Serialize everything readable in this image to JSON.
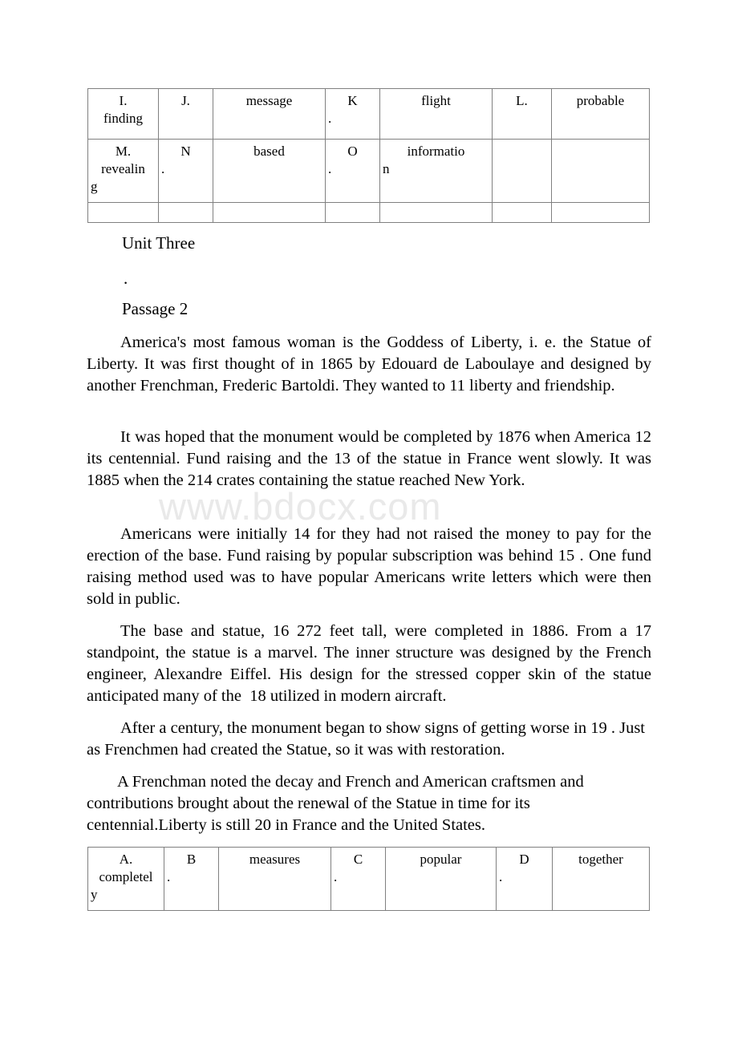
{
  "watermark": {
    "text": "www.bdocx.com"
  },
  "tables": {
    "top": {
      "rows": [
        [
          {
            "lines": [
              {
                "text": "I.",
                "align": "center"
              },
              {
                "text": "finding",
                "align": "center"
              }
            ]
          },
          {
            "lines": [
              {
                "text": "J.",
                "align": "center"
              }
            ]
          },
          {
            "lines": [
              {
                "text": "message",
                "align": "center"
              }
            ]
          },
          {
            "lines": [
              {
                "text": "K",
                "align": "center"
              },
              {
                "text": ".",
                "align": "left"
              }
            ]
          },
          {
            "lines": [
              {
                "text": "flight",
                "align": "center"
              }
            ]
          },
          {
            "lines": [
              {
                "text": "L.",
                "align": "center"
              }
            ]
          },
          {
            "lines": [
              {
                "text": "probable",
                "align": "center"
              }
            ]
          }
        ],
        [
          {
            "lines": [
              {
                "text": "M.",
                "align": "center"
              },
              {
                "text": "revealin",
                "align": "center"
              },
              {
                "text": "g",
                "align": "left"
              }
            ]
          },
          {
            "lines": [
              {
                "text": "N",
                "align": "center"
              },
              {
                "text": ".",
                "align": "left"
              }
            ]
          },
          {
            "lines": [
              {
                "text": "based",
                "align": "center"
              }
            ]
          },
          {
            "lines": [
              {
                "text": "O",
                "align": "center"
              },
              {
                "text": ".",
                "align": "left"
              }
            ]
          },
          {
            "lines": [
              {
                "text": "informatio",
                "align": "center"
              },
              {
                "text": "n",
                "align": "left"
              }
            ]
          },
          {
            "lines": []
          },
          {
            "lines": []
          }
        ],
        [
          {
            "lines": []
          },
          {
            "lines": []
          },
          {
            "lines": []
          },
          {
            "lines": []
          },
          {
            "lines": []
          },
          {
            "lines": []
          },
          {
            "lines": []
          }
        ]
      ]
    },
    "bottom": {
      "rows": [
        [
          {
            "lines": [
              {
                "text": "A.",
                "align": "center"
              },
              {
                "text": "completel",
                "align": "center"
              },
              {
                "text": "y",
                "align": "left"
              }
            ]
          },
          {
            "lines": [
              {
                "text": "B",
                "align": "center"
              },
              {
                "text": ".",
                "align": "left"
              }
            ]
          },
          {
            "lines": [
              {
                "text": "measures",
                "align": "center"
              }
            ]
          },
          {
            "lines": [
              {
                "text": "C",
                "align": "center"
              },
              {
                "text": ".",
                "align": "left"
              }
            ]
          },
          {
            "lines": [
              {
                "text": "popular",
                "align": "center"
              }
            ]
          },
          {
            "lines": [
              {
                "text": "D",
                "align": "center"
              },
              {
                "text": ".",
                "align": "left"
              }
            ]
          },
          {
            "lines": [
              {
                "text": "together",
                "align": "center"
              }
            ]
          }
        ]
      ]
    }
  },
  "headings": {
    "unit": "Unit Three",
    "dot": ".",
    "passage": "Passage 2"
  },
  "paragraphs": {
    "p1": "America's most famous woman is the Goddess of Liberty, i. e. the Statue of Liberty. It was first thought of in 1865 by Edouard de Laboulaye and designed by another Frenchman, Frederic Bartoldi. They wanted to 11 liberty and friendship.",
    "p2": "It was hoped that the monument would be completed by 1876 when America 12 its centennial. Fund raising and the 13 of the statue in France went slowly. It was 1885 when the 214 crates containing the statue reached New York.",
    "p3": "Americans were initially 14 for they had not raised the money to pay for the erection of the base. Fund raising by popular subscription was behind 15 . One fund raising method used was to have popular Americans write letters which were then sold in public.",
    "p4": "The base and statue, 16 272 feet tall, were completed in 1886. From a 17 standpoint, the statue is a marvel. The inner structure was designed by the French engineer, Alexandre Eiffel. His design for the stressed copper skin of the statue anticipated many of the  18 utilized in modern aircraft.",
    "p5": "After a century, the monument began to show signs of getting worse in 19 . Just as Frenchmen had created the Statue, so it was with restoration.",
    "p6": "A Frenchman noted the decay and French and American craftsmen and contributions brought about the renewal of the Statue in time for its centennial.Liberty is still 20 in France and the United States."
  }
}
